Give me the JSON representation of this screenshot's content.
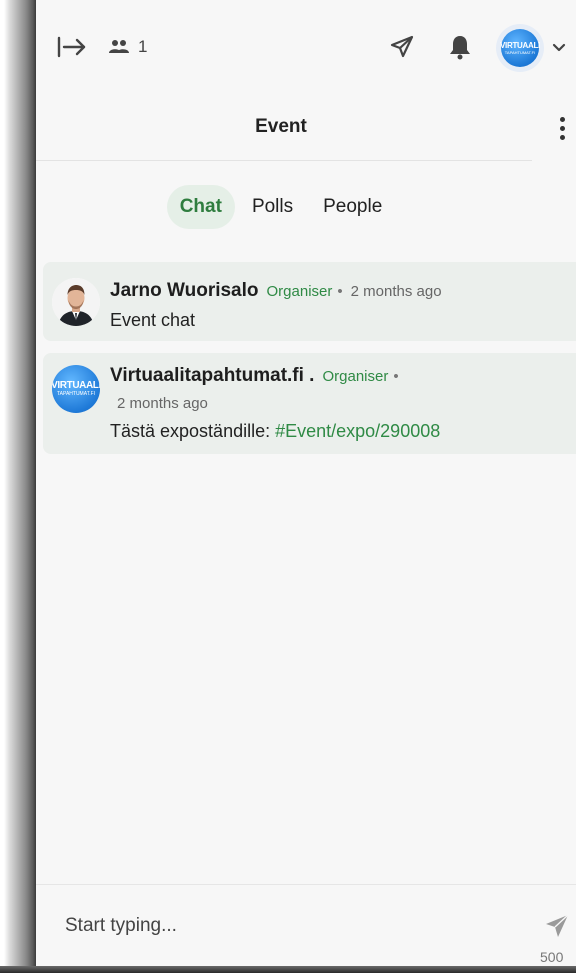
{
  "topbar": {
    "participant_count": "1",
    "icons": [
      "collapse-panel-icon",
      "people-icon",
      "send-icon",
      "bell-icon",
      "avatar",
      "chevron-down-icon"
    ],
    "avatar_text_line1": "VIRTUAALI",
    "avatar_text_line2": "TAPAHTUMAT.FI"
  },
  "header": {
    "title": "Event"
  },
  "tabs": [
    {
      "label": "Chat",
      "active": true
    },
    {
      "label": "Polls",
      "active": false
    },
    {
      "label": "People",
      "active": false
    }
  ],
  "messages": [
    {
      "author": "Jarno Wuorisalo",
      "role": "Organiser",
      "separator": "•",
      "time": "2 months ago",
      "text": "Event chat"
    },
    {
      "author": "Virtuaalitapahtumat.fi .",
      "role": "Organiser",
      "separator": "•",
      "time": "2 months ago",
      "text_prefix": "Tästä expoständille: ",
      "link": "#Event/expo/290008",
      "avatar_line1": "VIRTUAALI",
      "avatar_line2": "TAPAHTUMAT.FI"
    }
  ],
  "composer": {
    "placeholder": "Start typing...",
    "char_limit": "500"
  },
  "colors": {
    "accent": "#2f8a45",
    "active_tab_bg": "#e5efe7",
    "message_bg": "#ebefec",
    "panel_bg": "#f7f7f7"
  }
}
